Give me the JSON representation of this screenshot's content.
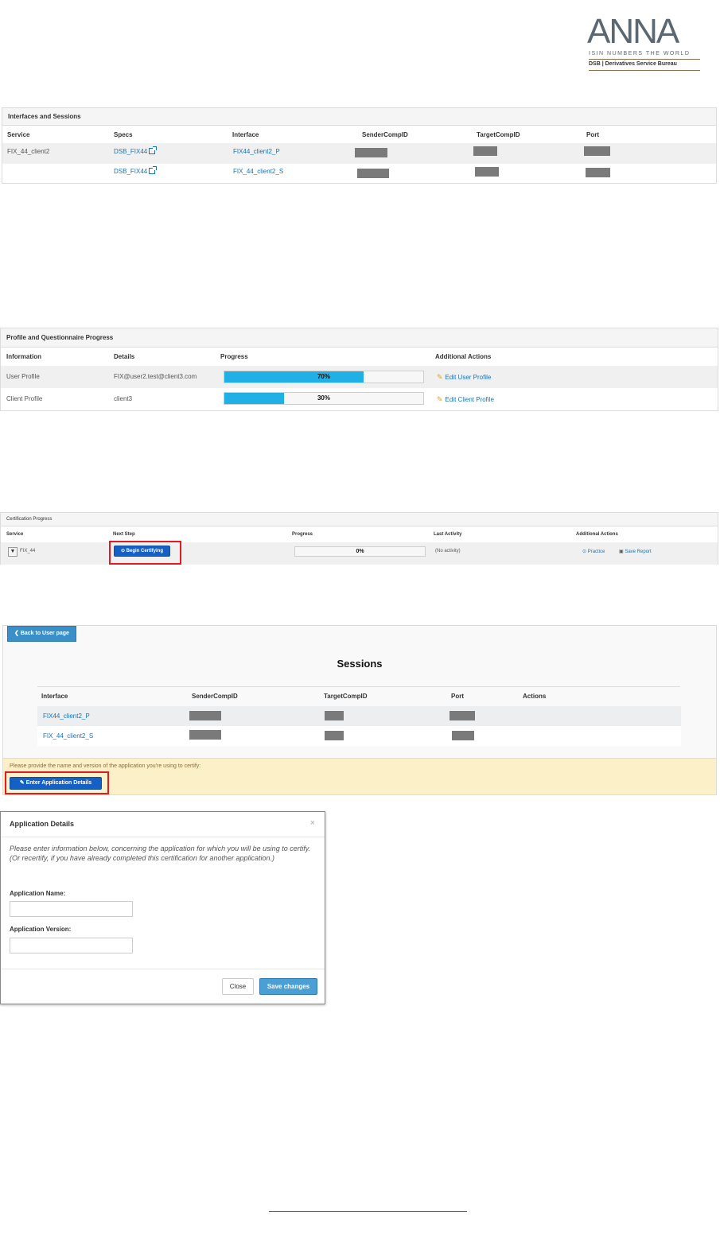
{
  "logo": {
    "wordmark": "ANNA",
    "tagline": "ISIN NUMBERS THE WORLD",
    "subtitle": "DSB | Derivatives Service Bureau"
  },
  "interfaces_panel": {
    "title": "Interfaces and Sessions",
    "headers": [
      "Service",
      "Specs",
      "Interface",
      "SenderCompID",
      "TargetCompID",
      "Port"
    ],
    "rows": [
      {
        "service": "FIX_44_client2",
        "spec": "DSB_FIX44",
        "interface": "FIX44_client2_P"
      },
      {
        "service": "",
        "spec": "DSB_FIX44",
        "interface": "FIX_44_client2_S"
      }
    ]
  },
  "profile_panel": {
    "title": "Profile and Questionnaire Progress",
    "headers": [
      "Information",
      "Details",
      "Progress",
      "Additional Actions"
    ],
    "rows": [
      {
        "info": "User Profile",
        "details": "FIX@user2.test@client3.com",
        "progress": 70,
        "progress_label": "70%",
        "action": "Edit User Profile"
      },
      {
        "info": "Client Profile",
        "details": "client3",
        "progress": 30,
        "progress_label": "30%",
        "action": "Edit Client Profile"
      }
    ]
  },
  "cert_panel": {
    "title": "Certification Progress",
    "headers": [
      "Service",
      "Next Step",
      "Progress",
      "Last Activity",
      "Additional Actions"
    ],
    "row": {
      "service": "FIX_44",
      "next_step": "Begin Certifying",
      "progress": 0,
      "progress_label": "0%",
      "last_activity": "(No activity)",
      "practice": "Practice",
      "save_report": "Save Report"
    }
  },
  "sessions": {
    "back_label": "Back to User page",
    "title": "Sessions",
    "headers": [
      "Interface",
      "SenderCompID",
      "TargetCompID",
      "Port",
      "Actions"
    ],
    "rows": [
      {
        "interface": "FIX44_client2_P"
      },
      {
        "interface": "FIX_44_client2_S"
      }
    ],
    "notice": "Please provide the name and version of the application you're using to certify:",
    "enter_button": "Enter Application Details"
  },
  "modal": {
    "title": "Application Details",
    "close_glyph": "×",
    "intro": "Please enter information below, concerning the application for which you will be using to certify. (Or recertify, if you have already completed this certification for another application.)",
    "name_label": "Application Name:",
    "name_value": "",
    "version_label": "Application Version:",
    "version_value": "",
    "close_button": "Close",
    "save_button": "Save changes"
  },
  "colors": {
    "progress_fill": "#1fb1e6",
    "primary_button": "#1560c4",
    "highlight_box": "#e01b24",
    "notice_bg": "#fcf0c8"
  }
}
